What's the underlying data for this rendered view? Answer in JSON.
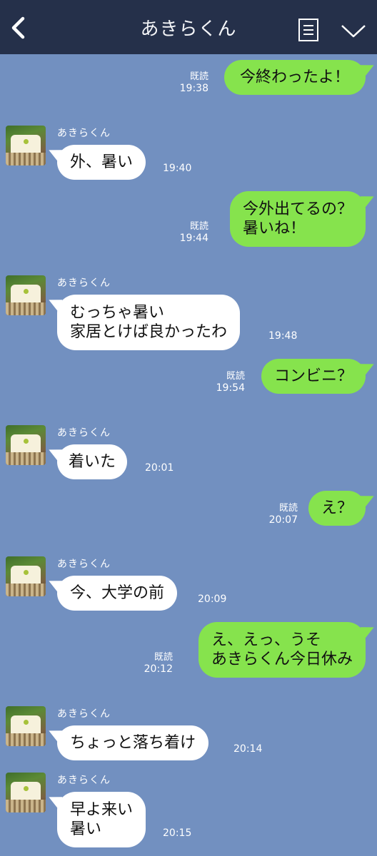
{
  "header": {
    "title": "あきらくん",
    "back_icon": "back-arrow-icon",
    "menu_icon": "notes-icon",
    "expand_icon": "chevron-down-icon",
    "background": "#25304a"
  },
  "chat": {
    "background": "#7290c0",
    "sent_color": "#86e34d",
    "received_color": "#ffffff",
    "messages": [
      {
        "dir": "sent",
        "text": "今終わったよ！",
        "read": "既読",
        "time": "19:38"
      },
      {
        "dir": "recv",
        "sender": "あきらくん",
        "text": "外、暑い",
        "time": "19:40"
      },
      {
        "dir": "sent",
        "text": "今外出てるの？\n暑いね！",
        "read": "既読",
        "time": "19:44"
      },
      {
        "dir": "recv",
        "sender": "あきらくん",
        "text": "むっちゃ暑い\n家居とけば良かったわ",
        "time": "19:48"
      },
      {
        "dir": "sent",
        "text": "コンビニ？",
        "read": "既読",
        "time": "19:54"
      },
      {
        "dir": "recv",
        "sender": "あきらくん",
        "text": "着いた",
        "time": "20:01"
      },
      {
        "dir": "sent",
        "text": "え？",
        "read": "既読",
        "time": "20:07"
      },
      {
        "dir": "recv",
        "sender": "あきらくん",
        "text": "今、大学の前",
        "time": "20:09"
      },
      {
        "dir": "sent",
        "text": "え、えっ、うそ\nあきらくん今日休み",
        "read": "既読",
        "time": "20:12"
      },
      {
        "dir": "recv",
        "sender": "あきらくん",
        "text": "ちょっと落ち着け",
        "time": "20:14"
      },
      {
        "dir": "recv",
        "sender": "あきらくん",
        "text": "早よ来い\n暑い",
        "time": "20:15"
      }
    ]
  }
}
